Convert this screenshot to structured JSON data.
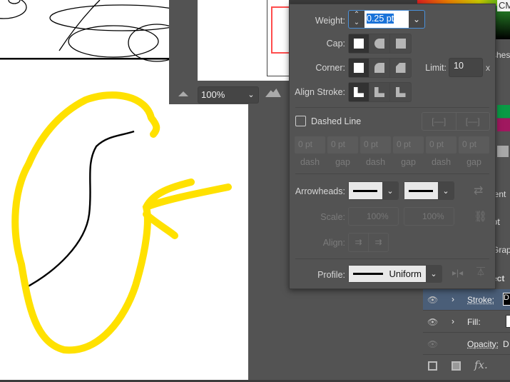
{
  "navigator": {
    "zoom": "100%"
  },
  "stroke_panel": {
    "weight_label": "Weight:",
    "weight_value": "0.25 pt",
    "cap_label": "Cap:",
    "corner_label": "Corner:",
    "limit_label": "Limit:",
    "limit_value": "10",
    "limit_unit": "x",
    "align_stroke_label": "Align Stroke:",
    "dashed_line_label": "Dashed Line",
    "dashed_checked": false,
    "dash_fields": [
      {
        "value": "0 pt",
        "label": "dash"
      },
      {
        "value": "0 pt",
        "label": "gap"
      },
      {
        "value": "0 pt",
        "label": "dash"
      },
      {
        "value": "0 pt",
        "label": "gap"
      },
      {
        "value": "0 pt",
        "label": "dash"
      },
      {
        "value": "0 pt",
        "label": "gap"
      }
    ],
    "arrowheads_label": "Arrowheads:",
    "scale_label": "Scale:",
    "scale_start": "100%",
    "scale_end": "100%",
    "align_label": "Align:",
    "profile_label": "Profile:",
    "profile_value": "Uniform"
  },
  "right_panel": {
    "color_mode": "CM",
    "swatches_tab": "shes",
    "gradient_tab": "ient",
    "pt_value": "pt",
    "graphic_tab": "Grap",
    "select_tab": "ect"
  },
  "appearance": {
    "rows": [
      {
        "label": "Stroke:",
        "value": "D"
      },
      {
        "label": "Fill:",
        "value": ""
      },
      {
        "label": "Opacity:",
        "value": "D"
      }
    ]
  },
  "colors": {
    "highlight": "#FFE100",
    "accent": "#4a90d9",
    "selected_row": "#4a5e78"
  }
}
